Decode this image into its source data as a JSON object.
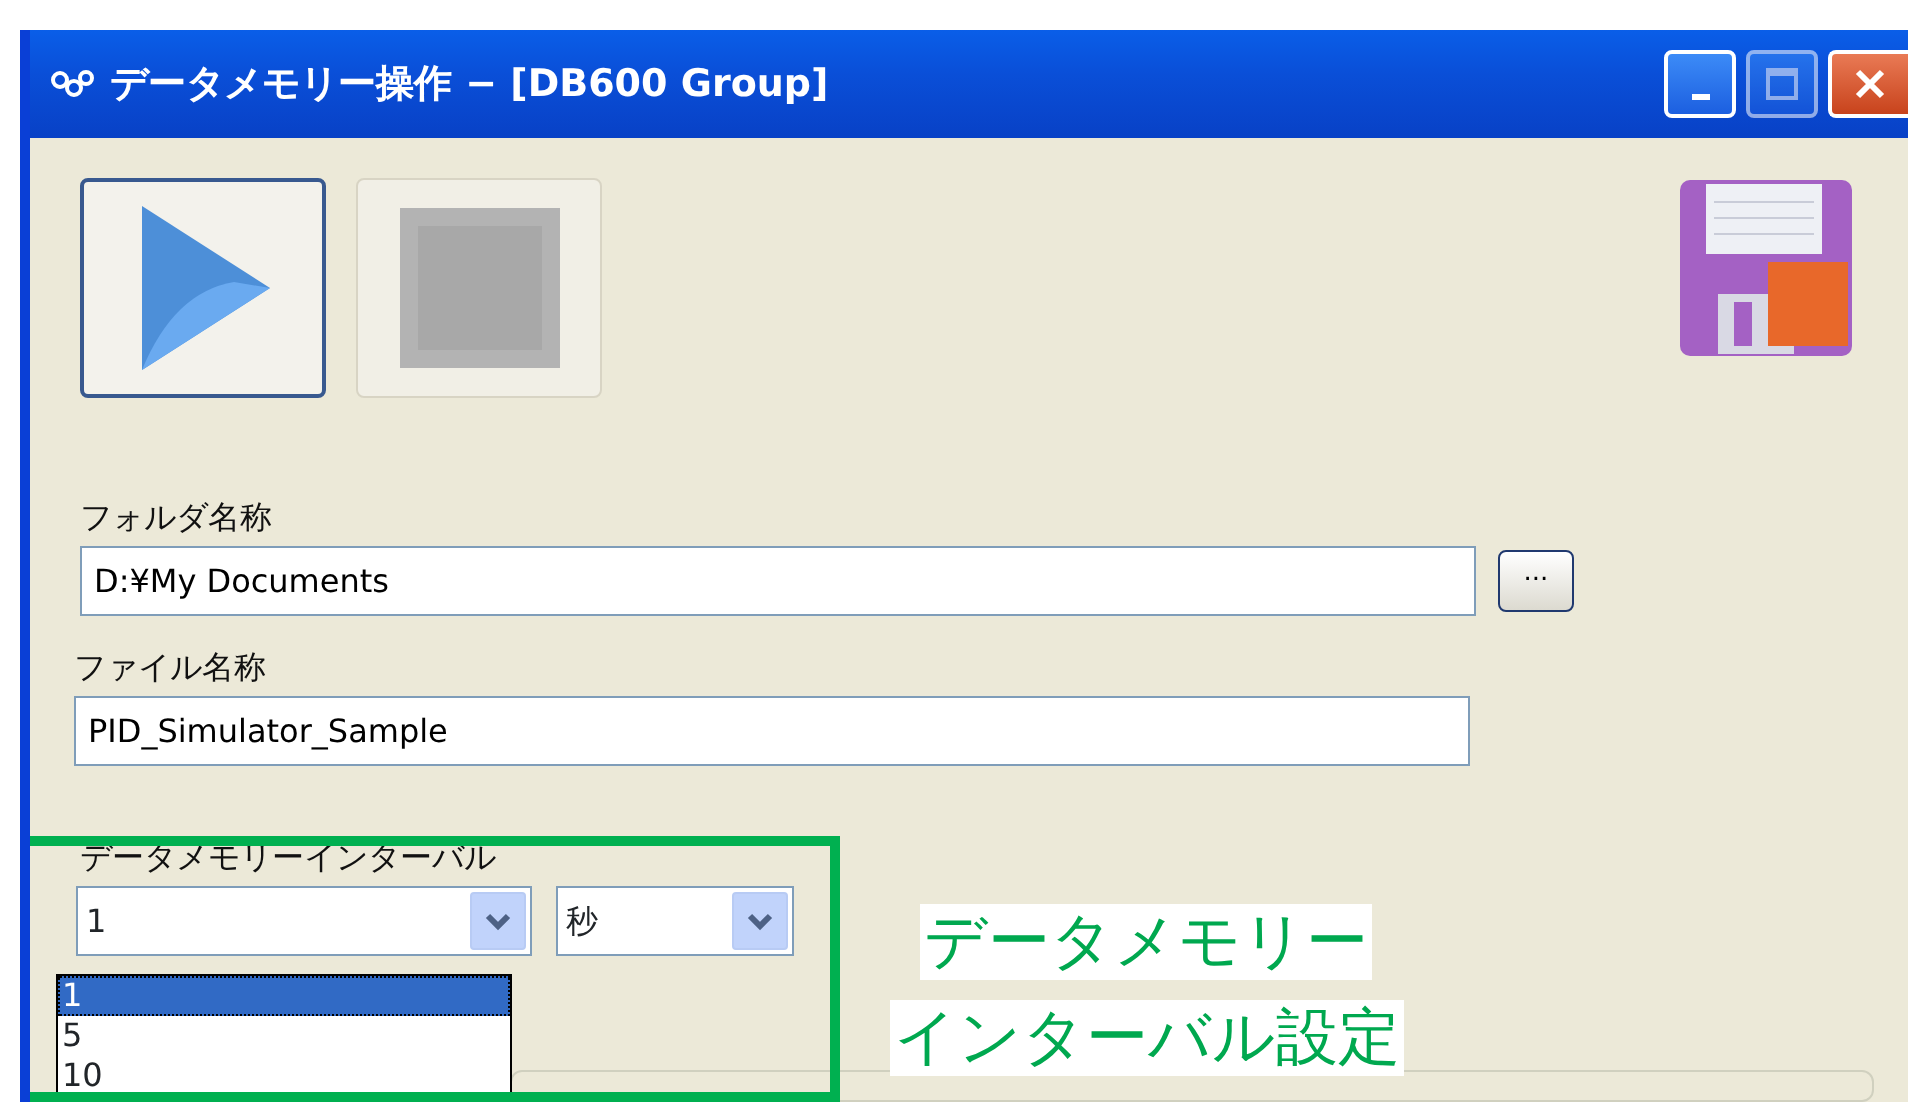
{
  "window": {
    "title": "データメモリー操作 − [DB600 Group]"
  },
  "toolbar": [
    {
      "kind": "play",
      "disabled": false
    },
    {
      "kind": "stop",
      "disabled": true
    }
  ],
  "folder": {
    "label": "フォルダ名称",
    "value": "D:¥My Documents",
    "browse_button": "..."
  },
  "file": {
    "label": "ファイル名称",
    "value": "PID_Simulator_Sample"
  },
  "interval": {
    "label": "データメモリーインターバル",
    "value": "1",
    "unit": "秒",
    "options": [
      {
        "label": "1",
        "selected": true
      },
      {
        "label": "5",
        "selected": false
      },
      {
        "label": "10",
        "selected": false
      }
    ]
  },
  "annotation": [
    "データメモリー",
    "インターバル設定"
  ]
}
